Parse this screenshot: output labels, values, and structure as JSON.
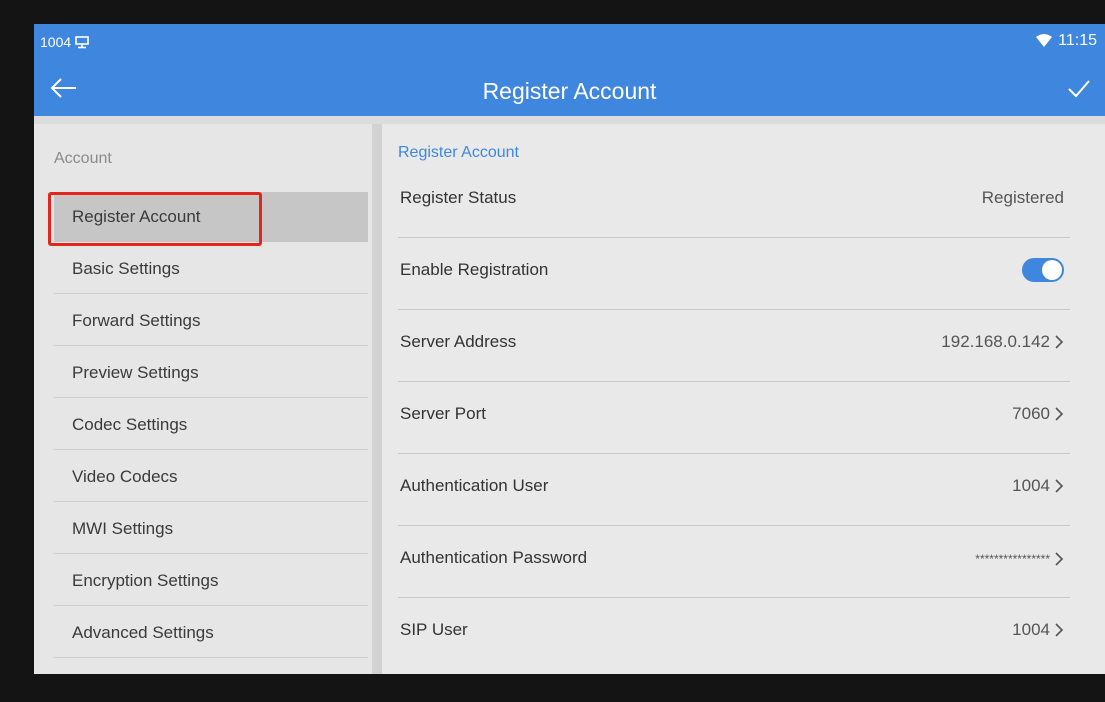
{
  "statusbar": {
    "left_text": "1004",
    "time": "11:15",
    "network_icon": "ethernet-icon",
    "signal_icon": "wifi-icon"
  },
  "header": {
    "title": "Register Account",
    "back_icon": "back-arrow-icon",
    "confirm_icon": "checkmark-icon"
  },
  "sidebar": {
    "category": "Account",
    "items": [
      {
        "label": "Register Account",
        "active": true
      },
      {
        "label": "Basic Settings"
      },
      {
        "label": "Forward Settings"
      },
      {
        "label": "Preview Settings"
      },
      {
        "label": "Codec Settings"
      },
      {
        "label": "Video Codecs"
      },
      {
        "label": "MWI Settings"
      },
      {
        "label": "Encryption Settings"
      },
      {
        "label": "Advanced Settings"
      }
    ]
  },
  "content": {
    "title": "Register Account",
    "rows": [
      {
        "label": "Register Status",
        "value": "Registered"
      },
      {
        "label": "Enable Registration",
        "toggle_on": true
      },
      {
        "label": "Server Address",
        "value": "192.168.0.142"
      },
      {
        "label": "Server Port",
        "value": "7060"
      },
      {
        "label": "Authentication User",
        "value": "1004"
      },
      {
        "label": "Authentication Password",
        "value": "****************"
      },
      {
        "label": "SIP User",
        "value": "1004"
      }
    ]
  },
  "colors": {
    "accent": "#3f87de",
    "highlight": "#e3261b"
  }
}
